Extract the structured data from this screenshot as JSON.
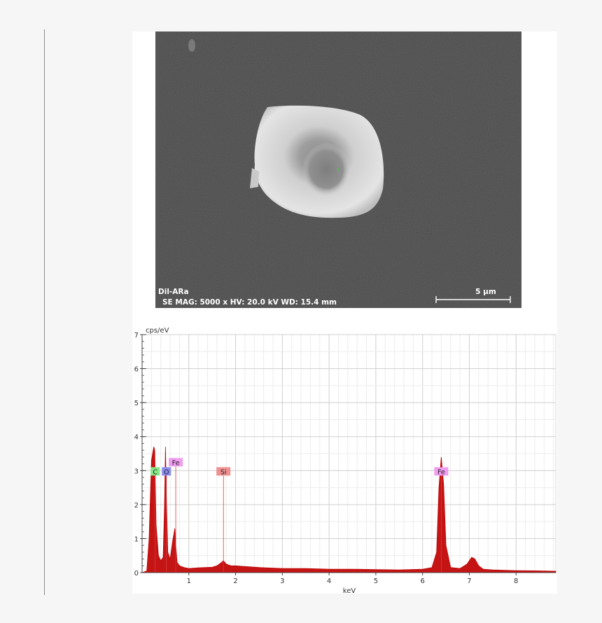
{
  "sem_image": {
    "sample_name": "Dil-ARa",
    "parameters": "SE  MAG: 5000 x  HV: 20.0 kV  WD: 15.4 mm",
    "scale_bar_label": "5 µm"
  },
  "chart_data": {
    "type": "line",
    "title": "",
    "xlabel": "keV",
    "ylabel": "cps/eV",
    "xlim": [
      0,
      8.85
    ],
    "ylim": [
      0,
      7
    ],
    "x_ticks": [
      1,
      2,
      3,
      4,
      5,
      6,
      7,
      8
    ],
    "y_ticks": [
      0,
      1,
      2,
      3,
      4,
      5,
      6,
      7
    ],
    "grid": true,
    "series": [
      {
        "color": "#c00000",
        "x": [
          0.0,
          0.1,
          0.15,
          0.2,
          0.25,
          0.27,
          0.3,
          0.35,
          0.4,
          0.45,
          0.48,
          0.5,
          0.52,
          0.55,
          0.6,
          0.65,
          0.7,
          0.72,
          0.75,
          0.8,
          0.9,
          1.0,
          1.2,
          1.5,
          1.6,
          1.7,
          1.74,
          1.8,
          1.9,
          2.0,
          2.2,
          2.5,
          3.0,
          3.5,
          4.0,
          4.5,
          5.0,
          5.5,
          6.0,
          6.2,
          6.3,
          6.35,
          6.4,
          6.45,
          6.5,
          6.6,
          6.8,
          6.95,
          7.05,
          7.12,
          7.2,
          7.3,
          7.5,
          8.0,
          8.5,
          8.85
        ],
        "y": [
          0.0,
          0.05,
          1.0,
          3.3,
          3.7,
          3.6,
          1.4,
          0.5,
          0.35,
          0.45,
          2.0,
          3.7,
          2.2,
          0.6,
          0.4,
          0.9,
          1.3,
          0.8,
          0.3,
          0.2,
          0.15,
          0.12,
          0.14,
          0.16,
          0.2,
          0.3,
          0.35,
          0.25,
          0.2,
          0.2,
          0.18,
          0.15,
          0.12,
          0.12,
          0.1,
          0.1,
          0.09,
          0.08,
          0.1,
          0.15,
          0.6,
          2.5,
          3.4,
          2.6,
          0.8,
          0.15,
          0.12,
          0.25,
          0.45,
          0.4,
          0.2,
          0.1,
          0.08,
          0.06,
          0.05,
          0.04
        ]
      }
    ],
    "peak_labels": [
      {
        "label": "C",
        "x": 0.28,
        "color": "#88e888"
      },
      {
        "label": "O",
        "x": 0.52,
        "color": "#8c8cf0"
      },
      {
        "label": "Fe",
        "x": 0.72,
        "color": "#f09cf0"
      },
      {
        "label": "Si",
        "x": 1.74,
        "color": "#f09090"
      },
      {
        "label": "Fe",
        "x": 6.4,
        "color": "#f09cf0"
      }
    ]
  }
}
